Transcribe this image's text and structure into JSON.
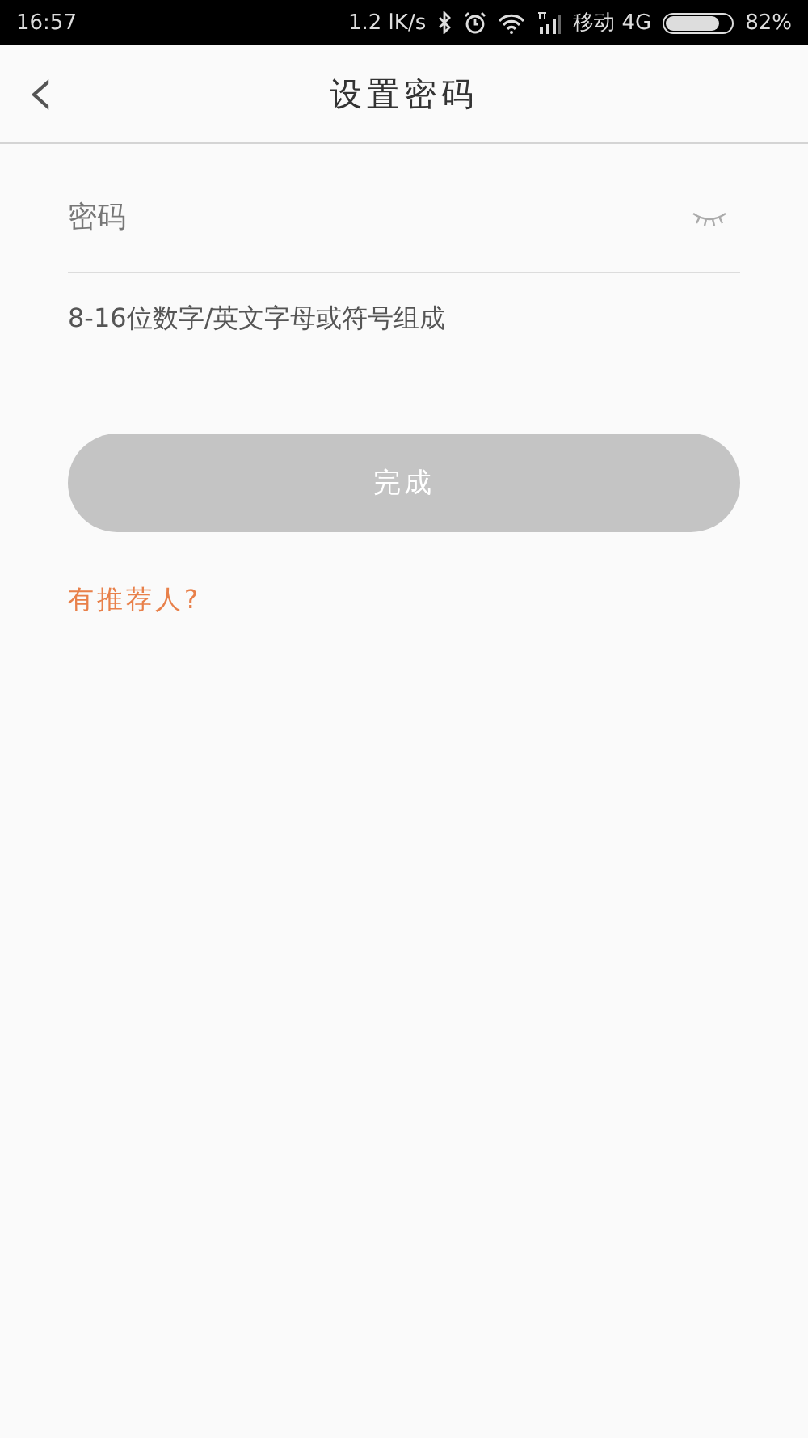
{
  "status_bar": {
    "time": "16:57",
    "speed": "1.2 lK/s",
    "carrier": "移动 4G",
    "battery": "82%"
  },
  "header": {
    "back": "‹",
    "title": "设置密码"
  },
  "password_field": {
    "placeholder": "密码"
  },
  "hint": "8-16位数字/英文字母或符号组成",
  "done_button": {
    "label": "完成",
    "disabled": true
  },
  "referrer_link": "有推荐人?"
}
